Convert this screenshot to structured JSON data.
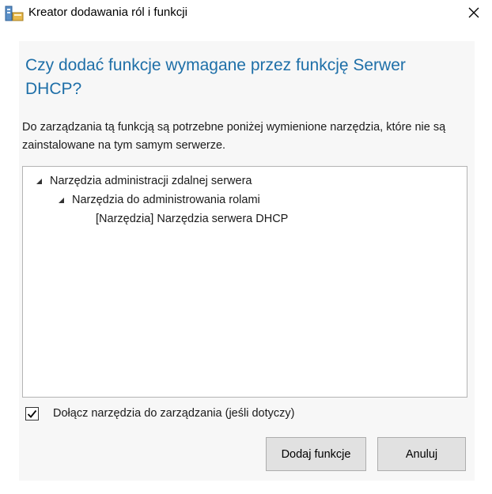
{
  "window": {
    "title": "Kreator dodawania ról i funkcji",
    "close_icon": "close-icon"
  },
  "dialog": {
    "heading": "Czy dodać funkcje wymagane przez funkcję Serwer DHCP?",
    "description": "Do zarządzania tą funkcją są potrzebne poniżej wymienione narzędzia, które nie są zainstalowane na tym samym serwerze.",
    "tree": [
      {
        "label": "Narzędzia administracji zdalnej serwera",
        "expanded": true,
        "level": 0
      },
      {
        "label": "Narzędzia do administrowania rolami",
        "expanded": true,
        "level": 1
      },
      {
        "label": "[Narzędzia] Narzędzia serwera DHCP",
        "level": 2
      }
    ],
    "checkbox": {
      "label": "Dołącz narzędzia do zarządzania (jeśli dotyczy)",
      "checked": true
    },
    "buttons": {
      "add_label": "Dodaj funkcje",
      "cancel_label": "Anuluj"
    }
  },
  "colors": {
    "heading": "#1e6fa8",
    "panel_bg": "#f7f7f7",
    "button_bg": "#e1e1e1"
  }
}
